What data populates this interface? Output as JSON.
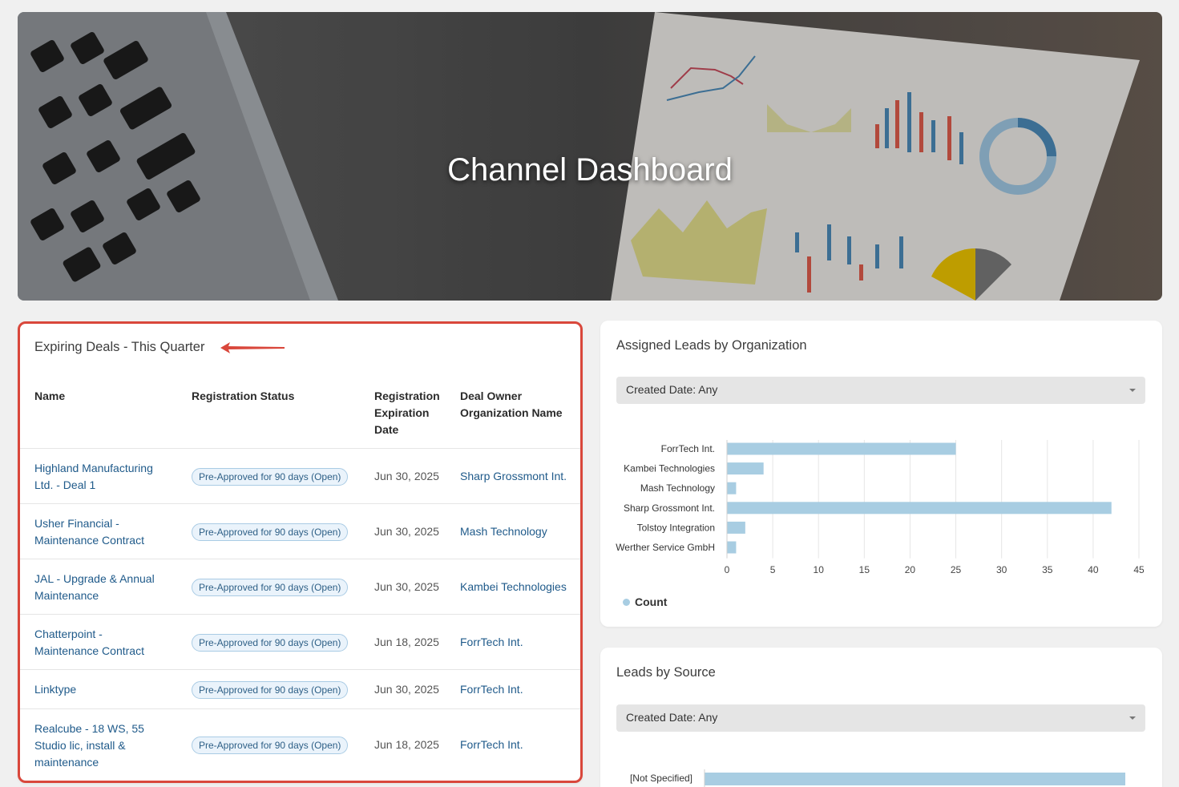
{
  "hero": {
    "title": "Channel Dashboard"
  },
  "deals": {
    "title": "Expiring Deals - This Quarter",
    "columns": {
      "name": "Name",
      "status": "Registration Status",
      "expiration": [
        "Registration",
        "Expiration",
        "Date"
      ],
      "owner": [
        "Deal Owner",
        "Organization Name"
      ]
    },
    "rows": [
      {
        "name": [
          "Highland Manufacturing",
          "Ltd. - Deal 1"
        ],
        "status": "Pre-Approved for 90 days (Open)",
        "date": "Jun 30, 2025",
        "org": "Sharp Grossmont Int."
      },
      {
        "name": [
          "Usher Financial -",
          "Maintenance Contract"
        ],
        "status": "Pre-Approved for 90 days (Open)",
        "date": "Jun 30, 2025",
        "org": "Mash Technology"
      },
      {
        "name": [
          "JAL - Upgrade & Annual",
          "Maintenance"
        ],
        "status": "Pre-Approved for 90 days (Open)",
        "date": "Jun 30, 2025",
        "org": "Kambei Technologies"
      },
      {
        "name": [
          "Chatterpoint -",
          "Maintenance Contract"
        ],
        "status": "Pre-Approved for 90 days (Open)",
        "date": "Jun 18, 2025",
        "org": "ForrTech Int."
      },
      {
        "name": [
          "Linktype"
        ],
        "status": "Pre-Approved for 90 days (Open)",
        "date": "Jun 30, 2025",
        "org": "ForrTech Int."
      },
      {
        "name": [
          "Realcube - 18 WS, 55",
          "Studio lic, install &",
          "maintenance"
        ],
        "status": "Pre-Approved for 90 days (Open)",
        "date": "Jun 18, 2025",
        "org": "ForrTech Int."
      }
    ]
  },
  "leads_org": {
    "title": "Assigned Leads by Organization",
    "filter": "Created Date: Any",
    "legend": "Count"
  },
  "leads_src": {
    "title": "Leads by Source",
    "filter": "Created Date: Any"
  },
  "colors": {
    "bar": "#a8cde2",
    "link": "#1f5a8a",
    "highlight": "#d9473b"
  },
  "chart_data": [
    {
      "type": "bar",
      "orientation": "horizontal",
      "categories": [
        "ForrTech Int.",
        "Kambei Technologies",
        "Mash Technology",
        "Sharp Grossmont Int.",
        "Tolstoy Integration",
        "Werther Service GmbH"
      ],
      "series": [
        {
          "name": "Count",
          "values": [
            25,
            4,
            1,
            42,
            2,
            1
          ]
        }
      ],
      "xlim": [
        0,
        45
      ],
      "xticks": [
        0,
        5,
        10,
        15,
        20,
        25,
        30,
        35,
        40,
        45
      ],
      "legend": "bottom-left",
      "grid": true
    },
    {
      "type": "bar",
      "orientation": "horizontal",
      "categories": [
        "[Not Specified]"
      ],
      "series": [
        {
          "values": [
            45
          ]
        }
      ]
    }
  ]
}
